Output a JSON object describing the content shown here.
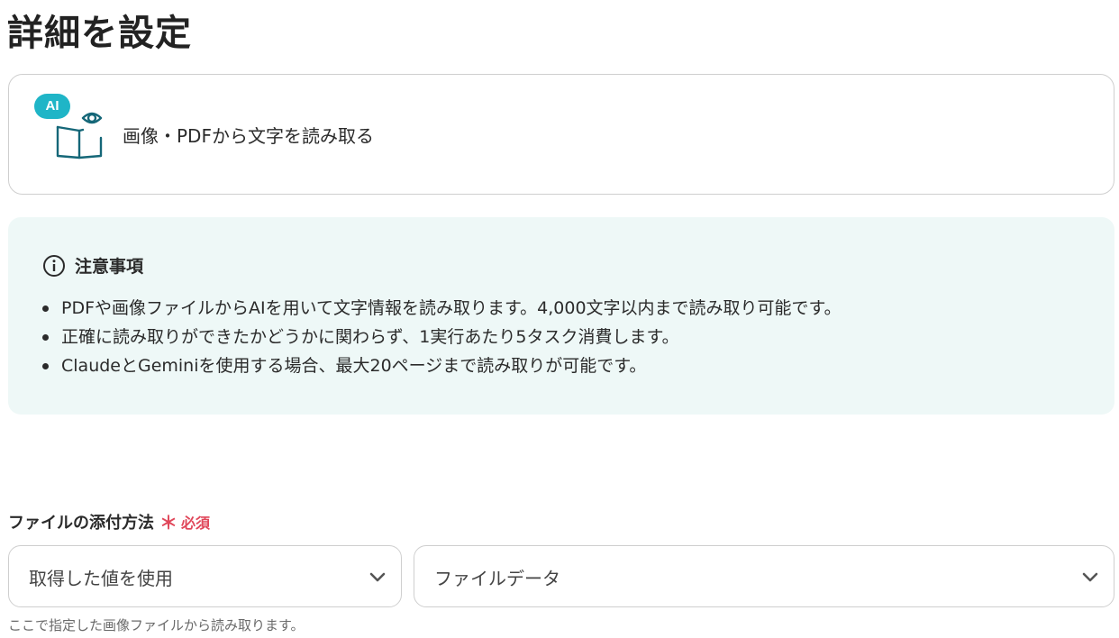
{
  "page": {
    "title": "詳細を設定"
  },
  "action": {
    "badge": "AI",
    "label": "画像・PDFから文字を読み取る",
    "icon": "book-eye-icon",
    "accent": "#1fb5c7",
    "icon_color": "#156778"
  },
  "notice": {
    "title": "注意事項",
    "icon": "info-icon",
    "background": "#eef8f7",
    "items": [
      "PDFや画像ファイルからAIを用いて文字情報を読み取ります。4,000文字以内まで読み取り可能です。",
      "正確に読み取りができたかどうかに関わらず、1実行あたり5タスク消費します。",
      "ClaudeとGeminiを使用する場合、最大20ページまで読み取りが可能です。"
    ]
  },
  "field": {
    "label": "ファイルの添付方法",
    "required_mark": "＊",
    "required_text": "必須",
    "required_color": "#e0475a",
    "method_select": {
      "value": "取得した値を使用",
      "icon": "chevron-down-icon"
    },
    "source_select": {
      "value": "ファイルデータ",
      "icon": "chevron-down-icon"
    },
    "hint": "ここで指定した画像ファイルから読み取ります。"
  }
}
